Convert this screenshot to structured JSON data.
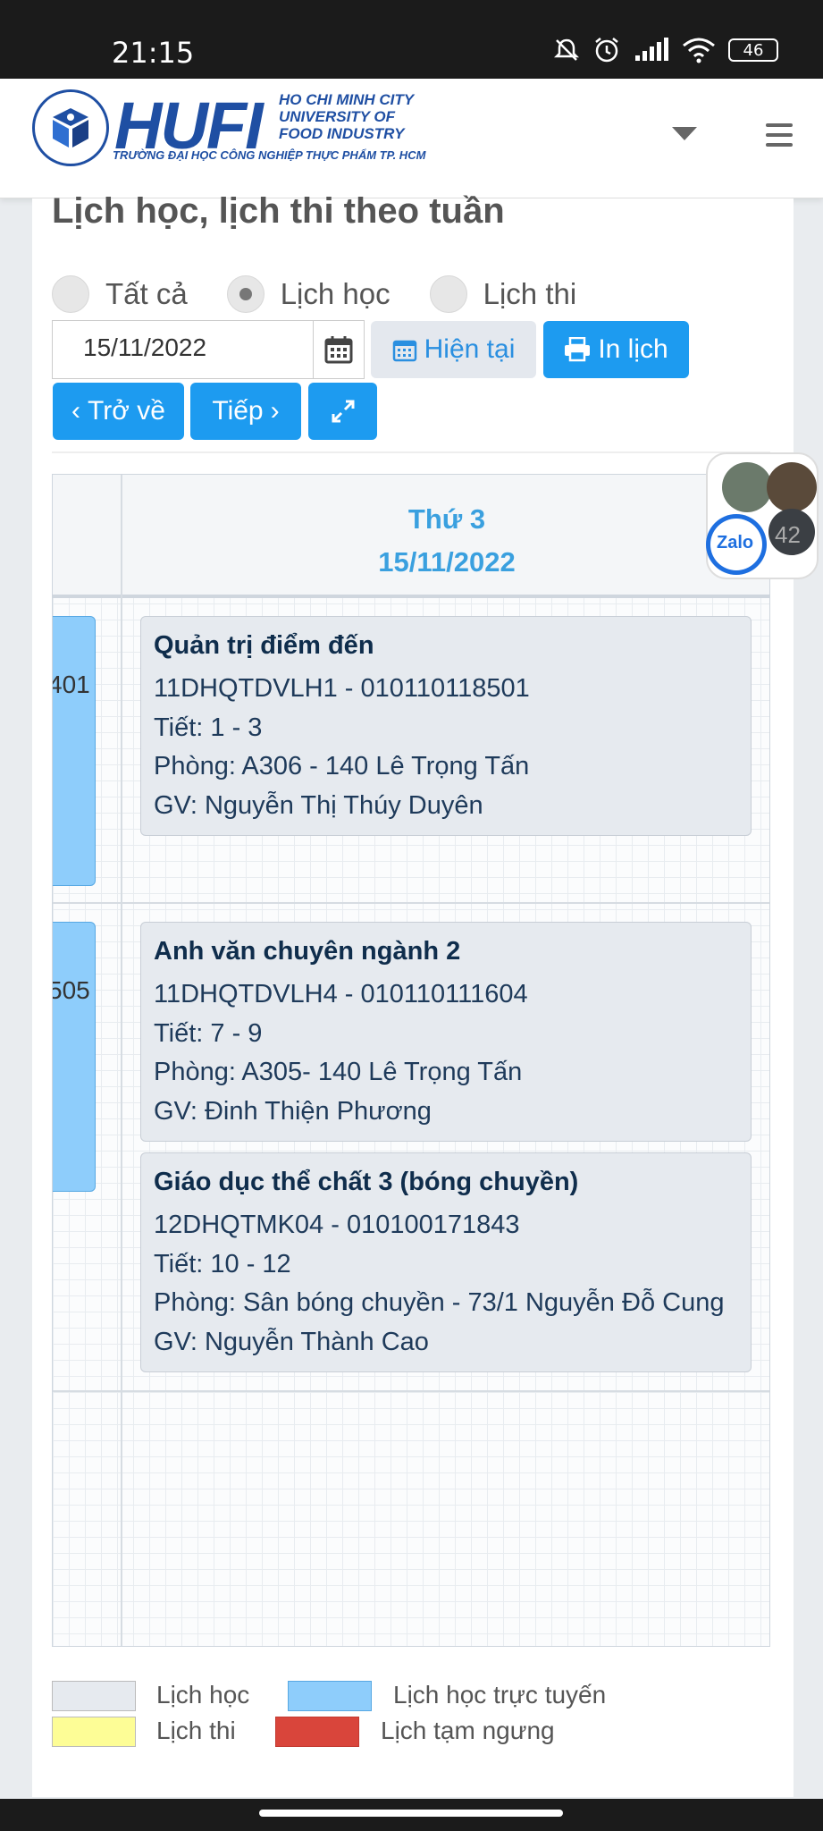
{
  "status_bar": {
    "time": "21:15",
    "battery": "46"
  },
  "header": {
    "logo_text": "HUFI",
    "logo_en": [
      "HO CHI MINH CITY",
      "UNIVERSITY OF",
      "FOOD INDUSTRY"
    ],
    "logo_vn": "TRƯỜNG ĐẠI HỌC CÔNG NGHIỆP THỰC PHẨM TP. HCM"
  },
  "page": {
    "title": "Lịch học, lịch thi theo tuần",
    "filters": {
      "all": "Tất cả",
      "study": "Lịch học",
      "exam": "Lịch thi",
      "selected": "Lịch học"
    },
    "date_value": "15/11/2022",
    "buttons": {
      "current": "Hiện tại",
      "print": "In lịch",
      "back": "Trở về",
      "next": "Tiếp"
    }
  },
  "schedule": {
    "day_name": "Thứ 3",
    "day_date": "15/11/2022",
    "left_clips": [
      "401",
      "505"
    ],
    "events": [
      {
        "title": "Quản trị điểm đến",
        "code": "11DHQTDVLH1 - 010110118501",
        "period": "Tiết: 1 - 3",
        "room": "Phòng: A306 - 140 Lê Trọng Tấn",
        "teacher": "GV: Nguyễn Thị Thúy Duyên"
      },
      {
        "title": "Anh văn chuyên ngành 2",
        "code": "11DHQTDVLH4 - 010110111604",
        "period": "Tiết: 7 - 9",
        "room": "Phòng: A305- 140 Lê Trọng Tấn",
        "teacher": "GV: Đinh Thiện Phương"
      },
      {
        "title": "Giáo dục thể chất 3 (bóng chuyền)",
        "code": "12DHQTMK04 - 010100171843",
        "period": "Tiết: 10 - 12",
        "room": "Phòng: Sân bóng chuyền - 73/1 Nguyễn Đỗ Cung",
        "teacher": "GV: Nguyễn Thành Cao"
      }
    ]
  },
  "legend": {
    "study": "Lịch học",
    "online": "Lịch học trực tuyến",
    "exam": "Lịch thi",
    "suspended": "Lịch tạm ngưng"
  },
  "zalo": {
    "label": "Zalo",
    "badge": "42"
  },
  "colors": {
    "primary": "#1d9bf0",
    "study": "#e6eaef",
    "online": "#8ecdfb",
    "exam": "#fdfd96",
    "suspended": "#d9453b",
    "logo_blue": "#1f4fa3"
  }
}
